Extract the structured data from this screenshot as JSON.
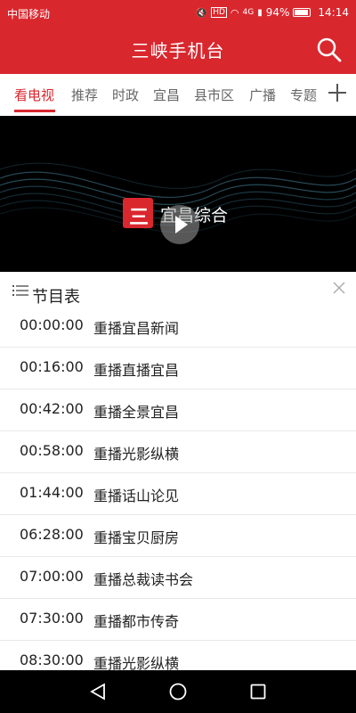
{
  "status_bar": {
    "carrier": "中国移动",
    "network": "4G",
    "hd": "HD",
    "battery": "94%",
    "time": "14:14"
  },
  "header": {
    "title": "三峡手机台",
    "search_icon": "search-icon"
  },
  "tabs": [
    {
      "label": "看电视",
      "active": true
    },
    {
      "label": "推荐",
      "active": false
    },
    {
      "label": "时政",
      "active": false
    },
    {
      "label": "宜昌",
      "active": false
    },
    {
      "label": "县市区",
      "active": false
    },
    {
      "label": "广播",
      "active": false
    },
    {
      "label": "专题",
      "active": false
    }
  ],
  "tab_add_icon": "plus-icon",
  "player": {
    "channel_name": "宜昌综合",
    "logo_glyph": "三",
    "play_icon": "play-icon"
  },
  "schedule": {
    "title": "节目表",
    "close_icon": "close-icon",
    "items": [
      {
        "time": "00:00:00",
        "title": "重播宜昌新闻"
      },
      {
        "time": "00:16:00",
        "title": "重播直播宜昌"
      },
      {
        "time": "00:42:00",
        "title": "重播全景宜昌"
      },
      {
        "time": "00:58:00",
        "title": "重播光影纵横"
      },
      {
        "time": "01:44:00",
        "title": "重播话山论见"
      },
      {
        "time": "06:28:00",
        "title": "重播宝贝厨房"
      },
      {
        "time": "07:00:00",
        "title": "重播总裁读书会"
      },
      {
        "time": "07:30:00",
        "title": "重播都市传奇"
      },
      {
        "time": "08:30:00",
        "title": "重播光影纵横"
      }
    ]
  },
  "nav": {
    "back_icon": "back-triangle-icon",
    "home_icon": "home-circle-icon",
    "recents_icon": "recents-square-icon"
  },
  "colors": {
    "brand_red": "#d9272e",
    "text": "#222222",
    "tab_inactive": "#666666",
    "divider": "#e8e8e8",
    "player_bg": "#000000"
  }
}
